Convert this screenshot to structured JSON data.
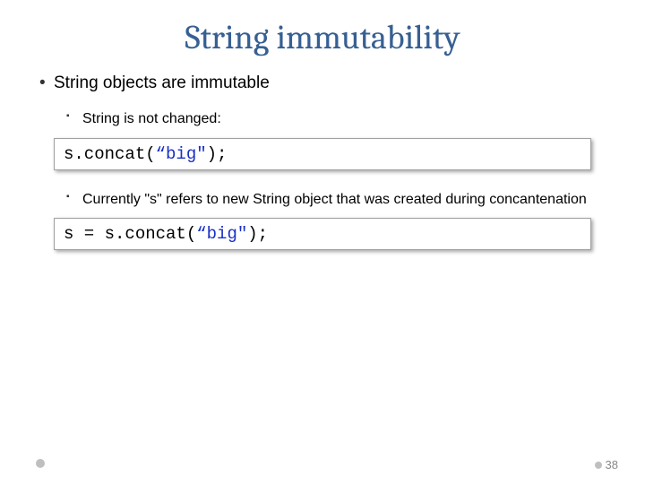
{
  "title": "String immutability",
  "bullets": {
    "main": "String objects are immutable",
    "sub1": "String is not changed:",
    "sub2": "Currently \"s\" refers to new String object that was created during concantenation"
  },
  "code1": {
    "part1": "s.concat(",
    "str": "“big\"",
    "part2": ");"
  },
  "code2": {
    "part1": "s = s.concat(",
    "str": "“big\"",
    "part2": ");"
  },
  "page_number": "38"
}
